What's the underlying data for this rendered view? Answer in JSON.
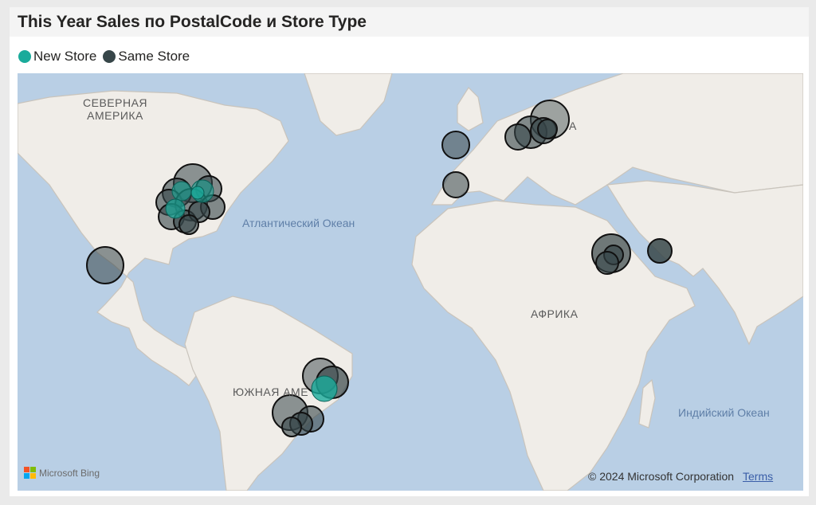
{
  "visual": {
    "title": "This Year Sales по PostalCode и Store Type"
  },
  "legend": {
    "items": [
      {
        "label": "New Store",
        "color": "#1aab9b"
      },
      {
        "label": "Same Store",
        "color": "#374649"
      }
    ]
  },
  "map": {
    "region_labels": {
      "north_america_line1": "СЕВЕРНАЯ",
      "north_america_line2": "АМЕРИКА",
      "south_america": "ЮЖНАЯ АМЕ",
      "africa": "АФРИКА",
      "asia_partial": "А"
    },
    "ocean_labels": {
      "atlantic": "Атлантический Океан",
      "indian": "Индийский Океан"
    },
    "colors": {
      "water": "#b9cfe5",
      "land": "#f0ede8",
      "border": "#c9c4bc",
      "new_store": "#1aab9b",
      "same_store": "#374649"
    }
  },
  "attribution": {
    "provider": "Microsoft Bing",
    "copyright": "© 2024 Microsoft Corporation",
    "terms": "Terms"
  }
}
